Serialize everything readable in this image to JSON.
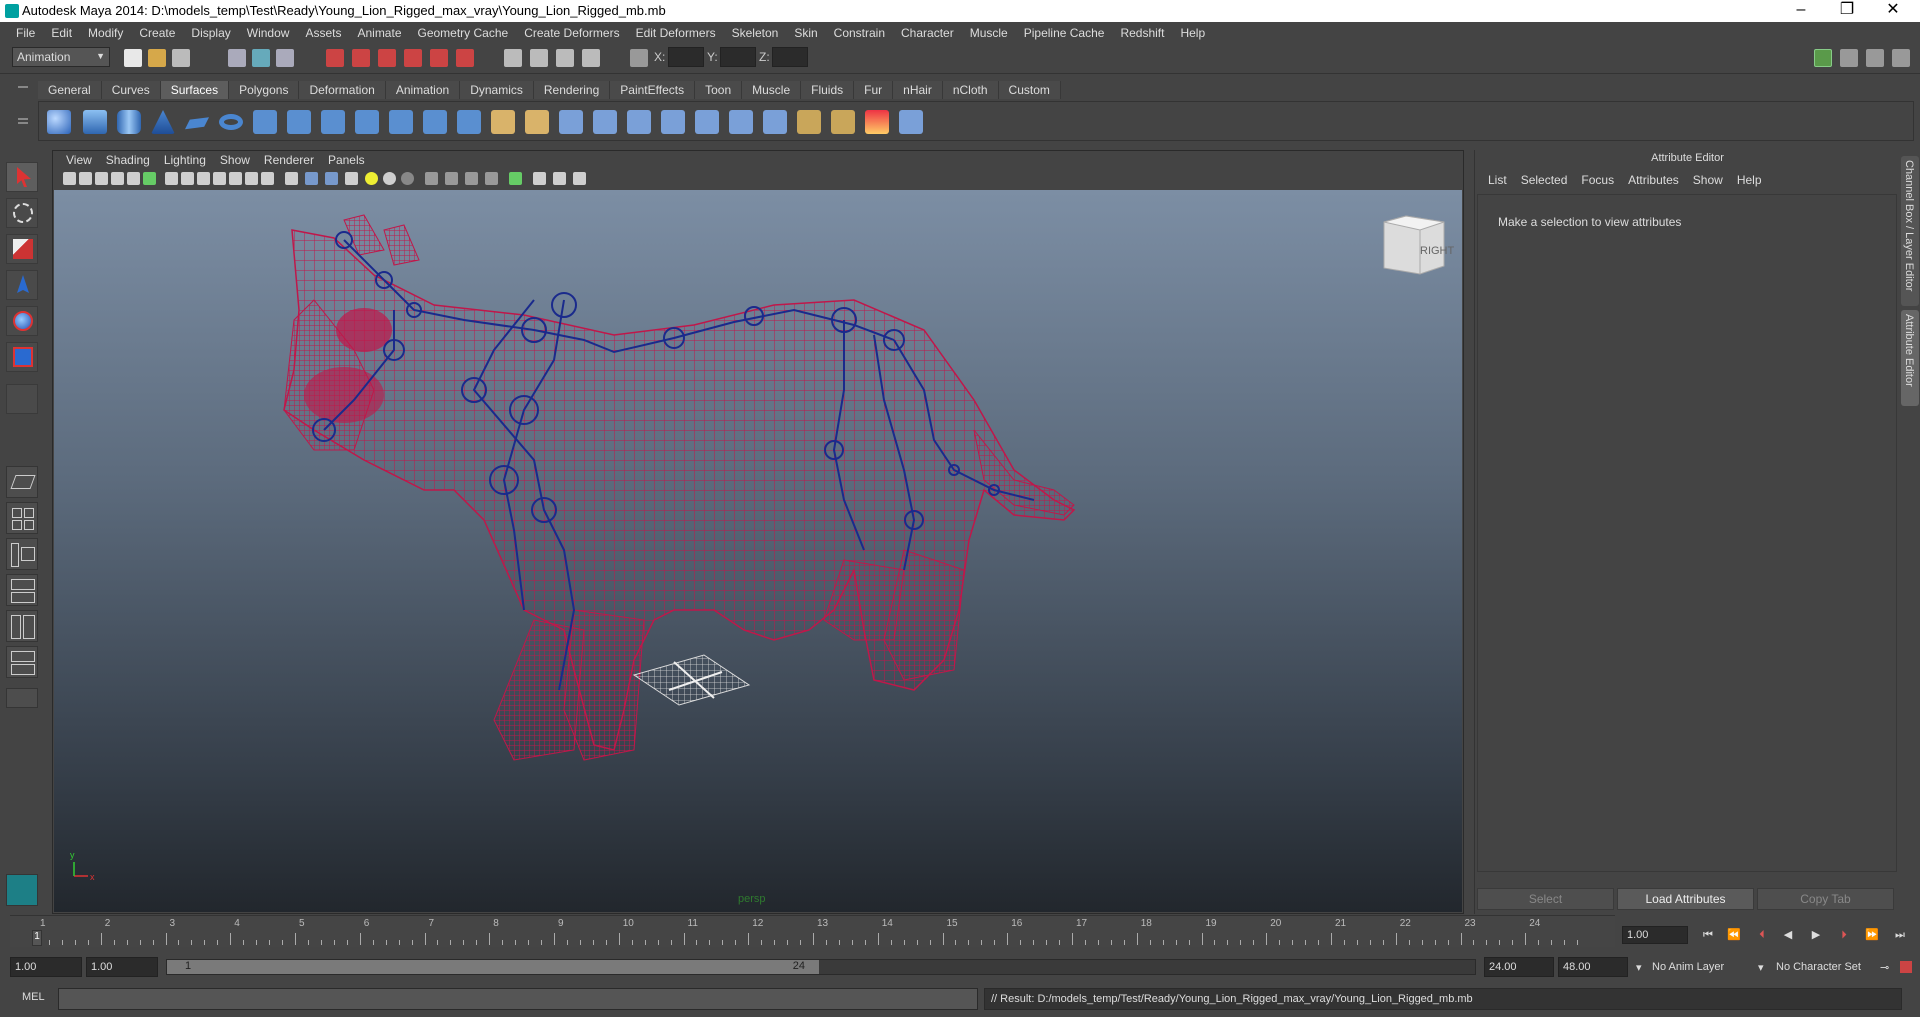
{
  "window": {
    "title": "Autodesk Maya 2014: D:\\models_temp\\Test\\Ready\\Young_Lion_Rigged_max_vray\\Young_Lion_Rigged_mb.mb",
    "minimize": "–",
    "restore": "❐",
    "close": "✕"
  },
  "menubar": [
    "File",
    "Edit",
    "Modify",
    "Create",
    "Display",
    "Window",
    "Assets",
    "Animate",
    "Geometry Cache",
    "Create Deformers",
    "Edit Deformers",
    "Skeleton",
    "Skin",
    "Constrain",
    "Character",
    "Muscle",
    "Pipeline Cache",
    "Redshift",
    "Help"
  ],
  "statusline": {
    "mode": "Animation",
    "x_label": "X:",
    "y_label": "Y:",
    "z_label": "Z:"
  },
  "shelf": {
    "tabs": [
      "General",
      "Curves",
      "Surfaces",
      "Polygons",
      "Deformation",
      "Animation",
      "Dynamics",
      "Rendering",
      "PaintEffects",
      "Toon",
      "Muscle",
      "Fluids",
      "Fur",
      "nHair",
      "nCloth",
      "Custom"
    ],
    "active_tab": "Surfaces"
  },
  "viewport": {
    "menu": [
      "View",
      "Shading",
      "Lighting",
      "Show",
      "Renderer",
      "Panels"
    ],
    "camera_label": "persp",
    "viewcube_label": "RIGHT",
    "axis_x": "x",
    "axis_y": "y"
  },
  "attribute_editor": {
    "title": "Attribute Editor",
    "menu": [
      "List",
      "Selected",
      "Focus",
      "Attributes",
      "Show",
      "Help"
    ],
    "message": "Make a selection to view attributes",
    "buttons": {
      "select": "Select",
      "load": "Load Attributes",
      "copy_tab": "Copy Tab"
    }
  },
  "side_tabs": {
    "channel_box": "Channel Box / Layer Editor",
    "attribute_editor": "Attribute Editor"
  },
  "timeline": {
    "tick_labels": [
      "1",
      "2",
      "3",
      "4",
      "5",
      "6",
      "7",
      "8",
      "9",
      "10",
      "11",
      "12",
      "13",
      "14",
      "15",
      "16",
      "17",
      "18",
      "19",
      "20",
      "21",
      "22",
      "23",
      "24"
    ],
    "current_frame": "1.00",
    "playhead_label": "1"
  },
  "range": {
    "start_time": "1.00",
    "playback_start": "1.00",
    "range_start_label": "1",
    "range_end_label": "24",
    "playback_end": "24.00",
    "end_time": "48.00",
    "anim_layer": "No Anim Layer",
    "character_set": "No Character Set"
  },
  "command_line": {
    "language": "MEL",
    "result": "// Result: D:/models_temp/Test/Ready/Young_Lion_Rigged_max_vray/Young_Lion_Rigged_mb.mb"
  },
  "colors": {
    "wireframe": "#c0174a",
    "skeleton": "#1a2a8c",
    "accent": "#00a0a0"
  }
}
